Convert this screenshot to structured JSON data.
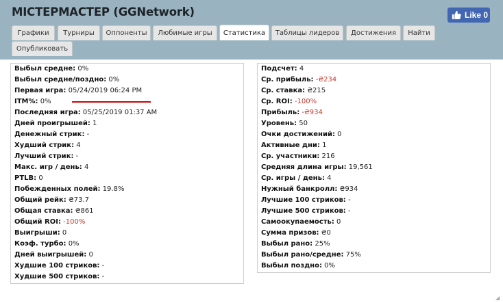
{
  "window": {
    "title": "MICTEPMACTEP (GGNetwork)",
    "fb_like_label": "Like 0"
  },
  "tabs": [
    {
      "label": "Графики"
    },
    {
      "label": "Турниры"
    },
    {
      "label": "Оппоненты"
    },
    {
      "label": "Любимые игры"
    },
    {
      "label": "Статистика",
      "active": true
    },
    {
      "label": "Таблицы лидеров"
    },
    {
      "label": "Достижения"
    },
    {
      "label": "Найти"
    },
    {
      "label": "Опубликовать"
    }
  ],
  "left_stats": [
    {
      "label": "Выбыл средне:",
      "value": "0%"
    },
    {
      "label": "Выбыл средне/поздно:",
      "value": "0%"
    },
    {
      "label": "Первая игра:",
      "value": "05/24/2019 06:24 PM"
    },
    {
      "label": "ITM%:",
      "value": "0%"
    },
    {
      "label": "Последняя игра:",
      "value": "05/25/2019 01:37 AM"
    },
    {
      "label": "Дней проигрышей:",
      "value": "1"
    },
    {
      "label": "Денежный стрик:",
      "value": "-"
    },
    {
      "label": "Худший стрик:",
      "value": "4"
    },
    {
      "label": "Лучший стрик:",
      "value": "-"
    },
    {
      "label": "Макс. игр / день:",
      "value": "4"
    },
    {
      "label": "PTLB:",
      "value": "0"
    },
    {
      "label": "Побежденных полей:",
      "value": "19.8%"
    },
    {
      "label": "Общий рейк:",
      "value": "₴73.7"
    },
    {
      "label": "Общая ставка:",
      "value": "₴861"
    },
    {
      "label": "Общий ROI:",
      "value": "-100%",
      "negative": true
    },
    {
      "label": "Выигрыши:",
      "value": "0"
    },
    {
      "label": "Коэф. турбо:",
      "value": "0%"
    },
    {
      "label": "Дней выигрышей:",
      "value": "0"
    },
    {
      "label": "Худшие 100 стриков:",
      "value": "-"
    },
    {
      "label": "Худшие 500 стриков:",
      "value": "-"
    }
  ],
  "right_stats": [
    {
      "label": "Подсчет:",
      "value": "4"
    },
    {
      "label": "Ср. прибыль:",
      "value": "-₴234",
      "negative": true
    },
    {
      "label": "Ср. ставка:",
      "value": "₴215"
    },
    {
      "label": "Ср. ROI:",
      "value": "-100%",
      "negative": true
    },
    {
      "label": "Прибыль:",
      "value": "-₴934",
      "negative": true
    },
    {
      "label": "Уровень:",
      "value": "50"
    },
    {
      "label": "Очки достижений:",
      "value": "0"
    },
    {
      "label": "Активные дни:",
      "value": "1"
    },
    {
      "label": "Ср. участники:",
      "value": "216"
    },
    {
      "label": "Средняя длина игры:",
      "value": "19,561"
    },
    {
      "label": "Ср. игры / день:",
      "value": "4"
    },
    {
      "label": "Нужный банкролл:",
      "value": "₴934"
    },
    {
      "label": "Лучшие 100 стриков:",
      "value": "-"
    },
    {
      "label": "Лучшие 500 стриков:",
      "value": "-"
    },
    {
      "label": "Самоокупаемость:",
      "value": "0"
    },
    {
      "label": "Сумма призов:",
      "value": "₴0"
    },
    {
      "label": "Выбыл рано:",
      "value": "25%"
    },
    {
      "label": "Выбыл рано/средне:",
      "value": "75%"
    },
    {
      "label": "Выбыл поздно:",
      "value": "0%"
    }
  ],
  "colors": {
    "header_bg": "#99b4c0",
    "negative_value": "#c0392b",
    "highlight_underline": "#d40000",
    "fb_blue": "#4267b2"
  }
}
